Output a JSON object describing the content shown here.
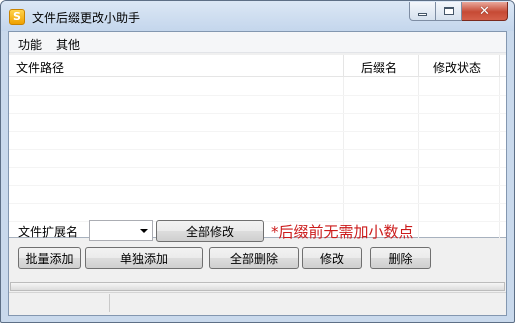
{
  "window": {
    "title": "文件后缀更改小助手",
    "icon_letter": "S",
    "minimize_icon": "minimize-icon",
    "maximize_icon": "maximize-icon",
    "close_glyph": "✕"
  },
  "menu": {
    "items": [
      {
        "label": "功能"
      },
      {
        "label": "其他"
      }
    ]
  },
  "table": {
    "columns": [
      {
        "label": "文件路径"
      },
      {
        "label": "后缀名"
      },
      {
        "label": "修改状态"
      }
    ],
    "rows": []
  },
  "controls": {
    "ext_label": "文件扩展名",
    "ext_value": "",
    "modify_all_label": "全部修改",
    "hint": "*后缀前无需加小数点",
    "hint_color": "#cc1b1b",
    "batch_add_label": "批量添加",
    "single_add_label": "单独添加",
    "delete_all_label": "全部删除",
    "modify_label": "修改",
    "delete_label": "删除"
  },
  "status": {
    "progress": 0,
    "left_text": "",
    "right_text": ""
  }
}
